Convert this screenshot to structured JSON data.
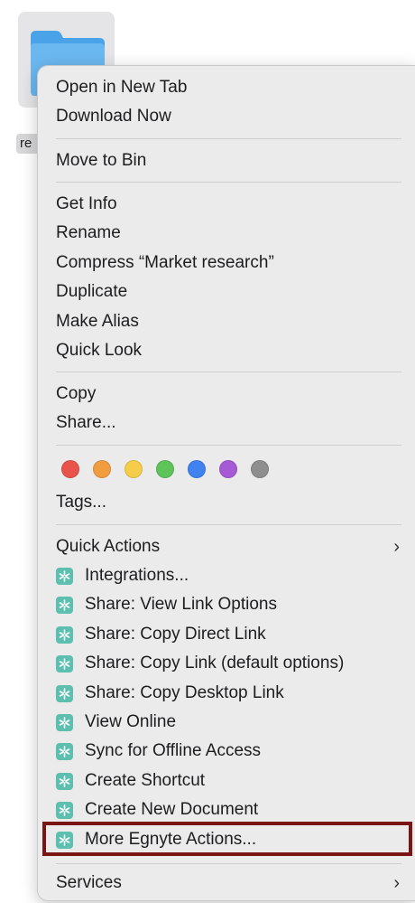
{
  "folder": {
    "label": "re",
    "icon": "folder-icon",
    "color": "#4aa3e8"
  },
  "menu": {
    "group_open": [
      {
        "label": "Open in New Tab"
      },
      {
        "label": "Download Now"
      }
    ],
    "group_bin": [
      {
        "label": "Move to Bin"
      }
    ],
    "group_file": [
      {
        "label": "Get Info"
      },
      {
        "label": "Rename"
      },
      {
        "label": "Compress “Market research”"
      },
      {
        "label": "Duplicate"
      },
      {
        "label": "Make Alias"
      },
      {
        "label": "Quick Look"
      }
    ],
    "group_copy": [
      {
        "label": "Copy"
      },
      {
        "label": "Share..."
      }
    ],
    "tags": {
      "colors": [
        "#e8534a",
        "#f09c3f",
        "#f5cd4b",
        "#5ec45a",
        "#3f82f0",
        "#a65ad6",
        "#8e8e8e"
      ],
      "label": "Tags..."
    },
    "quick_actions": {
      "label": "Quick Actions",
      "chevron": "›"
    },
    "egnyte_items": [
      {
        "label": "Integrations..."
      },
      {
        "label": "Share: View Link Options"
      },
      {
        "label": "Share: Copy Direct Link"
      },
      {
        "label": "Share: Copy Link (default options)"
      },
      {
        "label": "Share: Copy Desktop Link"
      },
      {
        "label": "View Online"
      },
      {
        "label": "Sync for Offline Access"
      },
      {
        "label": "Create Shortcut"
      },
      {
        "label": "Create New Document"
      },
      {
        "label": "More Egnyte Actions..."
      }
    ],
    "egnyte_icon": "egnyte-icon",
    "egnyte_icon_color": "#5dbfb0",
    "services": {
      "label": "Services",
      "chevron": "›"
    },
    "highlight_color": "#7a1515"
  }
}
